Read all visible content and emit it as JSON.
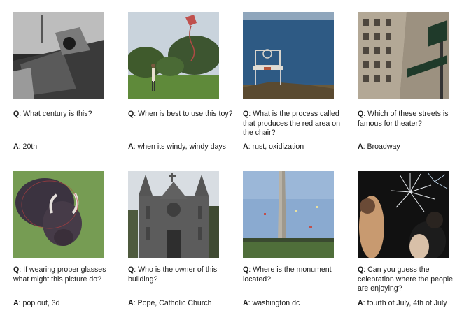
{
  "labels": {
    "q": "Q",
    "a": "A"
  },
  "examples": [
    {
      "question": "What century is this?",
      "answer": "20th",
      "image": "biplane-cockpit-photo"
    },
    {
      "question": "When is best to use this toy?",
      "answer": "when its windy, windy days",
      "image": "kite-in-park-photo"
    },
    {
      "question": "What is the process called that produces the red area on the chair?",
      "answer": "rust, oxidization",
      "image": "rusty-chair-by-sea-photo"
    },
    {
      "question": "Which of these streets is famous for theater?",
      "answer": "Broadway",
      "image": "broadway-street-sign-photo"
    },
    {
      "question": "If wearing proper glasses what might this picture do?",
      "answer": "pop out, 3d",
      "image": "anaglyph-yak-photo"
    },
    {
      "question": "Who is the owner of this building?",
      "answer": "Pope, Catholic Church",
      "image": "gothic-cathedral-photo"
    },
    {
      "question": "Where is the monument located?",
      "answer": "washington dc",
      "image": "washington-monument-photo"
    },
    {
      "question": "Can you guess the celebration where the people are enjoying?",
      "answer": "fourth of July, 4th of July",
      "image": "fireworks-crowd-photo"
    }
  ]
}
